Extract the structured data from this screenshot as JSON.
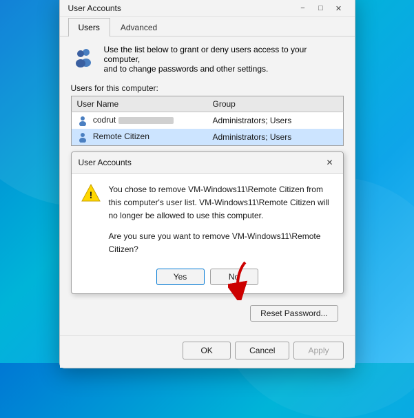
{
  "window": {
    "title": "User Accounts",
    "tabs": [
      {
        "label": "Users",
        "active": true
      },
      {
        "label": "Advanced",
        "active": false
      }
    ]
  },
  "info": {
    "text_line1": "Use the list below to grant or deny users access to your computer,",
    "text_line2": "and to change passwords and other settings."
  },
  "section_label": "Users for this computer:",
  "table": {
    "columns": [
      "User Name",
      "Group"
    ],
    "rows": [
      {
        "name": "codrut",
        "blurred": true,
        "group": "Administrators; Users",
        "selected": false
      },
      {
        "name": "Remote Citizen",
        "blurred": false,
        "group": "Administrators; Users",
        "selected": true
      }
    ]
  },
  "confirm_dialog": {
    "title": "User Accounts",
    "message_part1": "You chose to remove VM-Windows11\\Remote Citizen from this computer's user list. VM-Windows11\\Remote Citizen will no longer be allowed to use this computer.",
    "message_part2": "Are you sure you want to remove VM-Windows11\\Remote Citizen?",
    "yes_label": "Yes",
    "no_label": "No"
  },
  "reset_password_label": "Reset Password...",
  "footer": {
    "ok_label": "OK",
    "cancel_label": "Cancel",
    "apply_label": "Apply"
  }
}
